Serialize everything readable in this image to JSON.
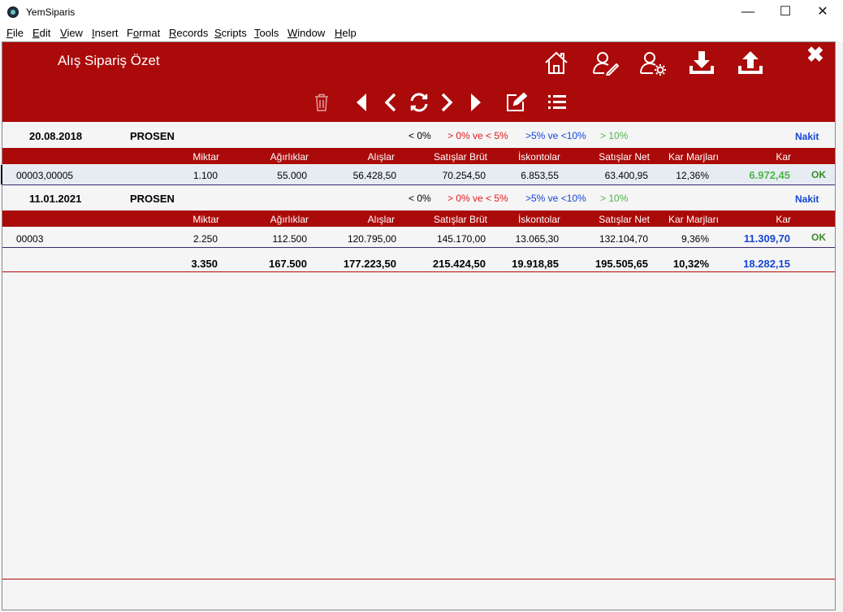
{
  "window": {
    "title": "YemSiparis",
    "minimize": "—",
    "maximize": "☐",
    "close": "✕"
  },
  "menu": [
    "File",
    "Edit",
    "View",
    "Insert",
    "Format",
    "Records",
    "Scripts",
    "Tools",
    "Window",
    "Help"
  ],
  "menu_underline": [
    "F",
    "E",
    "V",
    "I",
    "o",
    "R",
    "S",
    "T",
    "W",
    "H"
  ],
  "header": {
    "title": "Alış Sipariş Özet",
    "close_label": "✖",
    "icons": [
      "home-icon",
      "user-edit-icon",
      "user-settings-icon",
      "download-icon",
      "upload-icon"
    ],
    "toolbar_icons": [
      "trash-icon",
      "first-record-icon",
      "previous-record-icon",
      "refresh-icon",
      "next-record-icon",
      "last-record-icon",
      "edit-note-icon",
      "list-icon"
    ]
  },
  "legend": {
    "neg": "< 0%",
    "low": "> 0% ve < 5%",
    "mid": ">5% ve <10%",
    "high": "> 10%"
  },
  "columns": [
    "Miktar",
    "Ağırlıklar",
    "Alışlar",
    "Satışlar Brüt",
    "İskontolar",
    "Satışlar Net",
    "Kar Marjları",
    "Kar"
  ],
  "groups": [
    {
      "date": "20.08.2018",
      "name": "PROSEN",
      "payment": "Nakit",
      "row": {
        "code": "00003,00005",
        "miktar": "1.100",
        "agirlik": "55.000",
        "alis": "56.428,50",
        "satis_brut": "70.254,50",
        "iskonto": "6.853,55",
        "satis_net": "63.400,95",
        "kar_marji": "12,36%",
        "kar": "6.972,45",
        "status": "OK"
      }
    },
    {
      "date": "11.01.2021",
      "name": "PROSEN",
      "payment": "Nakit",
      "row": {
        "code": "00003",
        "miktar": "2.250",
        "agirlik": "112.500",
        "alis": "120.795,00",
        "satis_brut": "145.170,00",
        "iskonto": "13.065,30",
        "satis_net": "132.104,70",
        "kar_marji": "9,36%",
        "kar": "11.309,70",
        "status": "OK"
      }
    }
  ],
  "totals": {
    "miktar": "3.350",
    "agirlik": "167.500",
    "alis": "177.223,50",
    "satis_brut": "215.424,50",
    "iskonto": "19.918,85",
    "satis_net": "195.505,65",
    "kar_marji": "10,32%",
    "kar": "18.282,15"
  },
  "colors": {
    "header_red": "#ab0a0a",
    "legend_red": "#e21a1a",
    "legend_blue": "#1546d4",
    "legend_green": "#4fb44a"
  }
}
